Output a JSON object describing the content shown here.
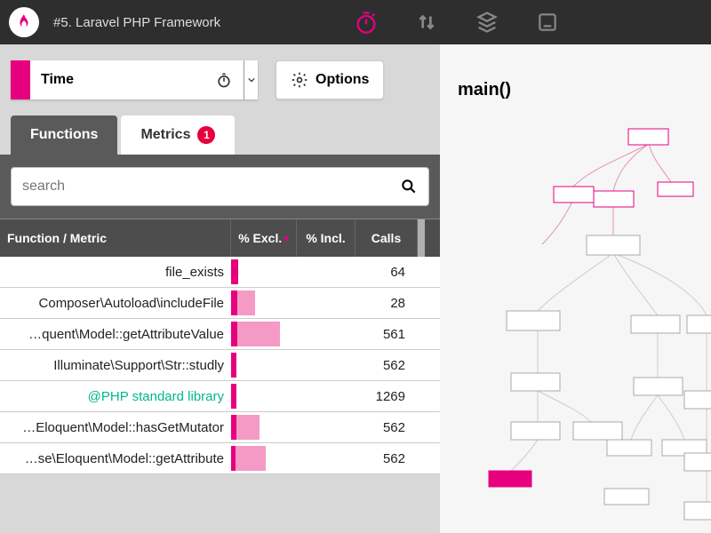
{
  "accent": "#e6007e",
  "header": {
    "title": "#5. Laravel PHP Framework"
  },
  "dimension": {
    "label": "Time"
  },
  "options_label": "Options",
  "tabs": {
    "functions": "Functions",
    "metrics": "Metrics",
    "metrics_badge": "1"
  },
  "search": {
    "placeholder": "search"
  },
  "columns": {
    "name": "Function / Metric",
    "excl": "% Excl.",
    "incl": "% Incl.",
    "calls": "Calls"
  },
  "rows": [
    {
      "name": "file_exists",
      "excl": 8,
      "incl": 0,
      "calls": "64",
      "green": false
    },
    {
      "name": "Composer\\Autoload\\includeFile",
      "excl": 7,
      "incl": 20,
      "calls": "28",
      "green": false
    },
    {
      "name": "…quent\\Model::getAttributeValue",
      "excl": 7,
      "incl": 48,
      "calls": "561",
      "green": false
    },
    {
      "name": "Illuminate\\Support\\Str::studly",
      "excl": 6,
      "incl": 0,
      "calls": "562",
      "green": false
    },
    {
      "name": "@PHP standard library",
      "excl": 6,
      "incl": 0,
      "calls": "1269",
      "green": true
    },
    {
      "name": "…Eloquent\\Model::hasGetMutator",
      "excl": 6,
      "incl": 26,
      "calls": "562",
      "green": false
    },
    {
      "name": "…se\\Eloquent\\Model::getAttribute",
      "excl": 5,
      "incl": 34,
      "calls": "562",
      "green": false
    }
  ],
  "right": {
    "title": "main()"
  }
}
